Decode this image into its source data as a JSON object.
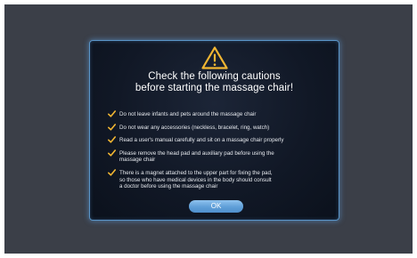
{
  "dialog": {
    "title_line1": "Check the following cautions",
    "title_line2": "before starting the massage chair!",
    "items": [
      {
        "lines": [
          "Do not leave infants and pets around the massage chair"
        ]
      },
      {
        "lines": [
          "Do not wear any accessories (neckless, bracelet, ring, watch)"
        ]
      },
      {
        "lines": [
          "Read a user's manual carefully and sit on a massage chair properly"
        ]
      },
      {
        "lines": [
          "Please remove the head pad and auxiliary pad before using the",
          "massage chair"
        ]
      },
      {
        "lines": [
          "There is a magnet attached to the upper part for fixing the pad,",
          "so those who have medical devices in the body should consult",
          "a doctor before using the massage chair"
        ]
      }
    ],
    "ok_label": "OK"
  },
  "colors": {
    "background": "#3b3f48",
    "dialog_border": "#5a95c8",
    "check_color": "#f2b632",
    "warning_icon": "#f2b632",
    "ok_button": "#6aa8de"
  },
  "icons": {
    "warning": "warning-triangle-icon",
    "check": "check-icon"
  }
}
